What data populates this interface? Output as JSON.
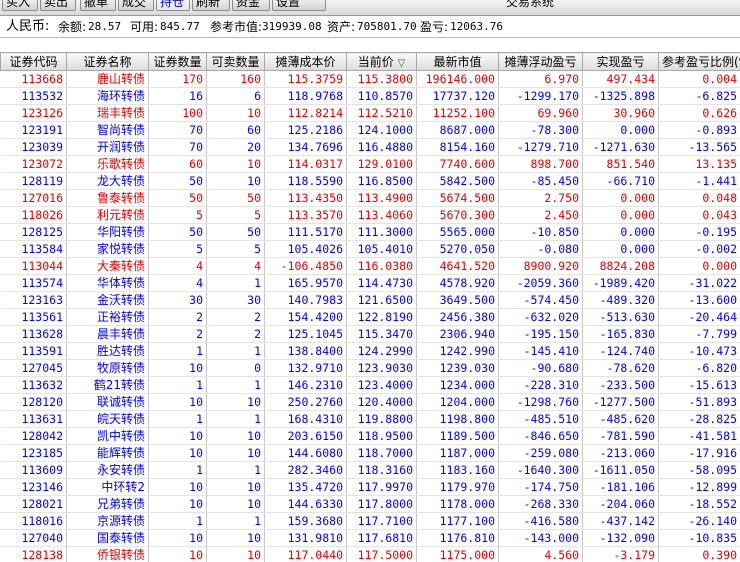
{
  "toolbar": {
    "buttons": [
      "买入",
      "卖出",
      "撤单",
      "成交",
      "持仓",
      "刷新",
      "资金",
      "设置"
    ],
    "title": "交易系统"
  },
  "summary": {
    "currency_label": "人民币:",
    "balance_label": "余额:",
    "balance": "28.57",
    "available_label": "可用:",
    "available": "845.77",
    "market_value_label": "参考市值:",
    "market_value": "319939.08",
    "assets_label": "资产:",
    "assets": "705801.70",
    "pnl_label": "盈亏:",
    "pnl": "12063.76"
  },
  "columns": [
    "证券代码",
    "证券名称",
    "证券数量",
    "可卖数量",
    "摊薄成本价",
    "当前价",
    "最新市值",
    "摊薄浮动盈亏",
    "实现盈亏",
    "参考盈亏比例(%)"
  ],
  "sort_indicator": "▽",
  "colors": {
    "up": "#e60000",
    "down": "#0000ff",
    "header_bg": "#e4e4e4"
  },
  "rows": [
    {
      "code": "113668",
      "name": "鹿山转债",
      "qty": "170",
      "sell": "160",
      "cost": "115.3759",
      "price": "115.3800",
      "mv": "196146.000",
      "float": "6.970",
      "real": "497.434",
      "ratio": "0.004",
      "dir": "up"
    },
    {
      "code": "113532",
      "name": "海环转债",
      "qty": "16",
      "sell": "6",
      "cost": "118.9768",
      "price": "110.8570",
      "mv": "17737.120",
      "float": "-1299.170",
      "real": "-1325.898",
      "ratio": "-6.825",
      "dir": "dn"
    },
    {
      "code": "123126",
      "name": "瑞丰转债",
      "qty": "100",
      "sell": "10",
      "cost": "112.8214",
      "price": "112.5210",
      "mv": "11252.100",
      "float": "69.960",
      "real": "30.960",
      "ratio": "0.626",
      "dir": "up"
    },
    {
      "code": "123191",
      "name": "智尚转债",
      "qty": "70",
      "sell": "60",
      "cost": "125.2186",
      "price": "124.1000",
      "mv": "8687.000",
      "float": "-78.300",
      "real": "0.000",
      "ratio": "-0.893",
      "dir": "dn"
    },
    {
      "code": "123039",
      "name": "开润转债",
      "qty": "70",
      "sell": "20",
      "cost": "134.7696",
      "price": "116.4880",
      "mv": "8154.160",
      "float": "-1279.710",
      "real": "-1271.630",
      "ratio": "-13.565",
      "dir": "dn"
    },
    {
      "code": "123072",
      "name": "乐歌转债",
      "qty": "60",
      "sell": "10",
      "cost": "114.0317",
      "price": "129.0100",
      "mv": "7740.600",
      "float": "898.700",
      "real": "851.540",
      "ratio": "13.135",
      "dir": "up"
    },
    {
      "code": "128119",
      "name": "龙大转债",
      "qty": "50",
      "sell": "10",
      "cost": "118.5590",
      "price": "116.8500",
      "mv": "5842.500",
      "float": "-85.450",
      "real": "-66.710",
      "ratio": "-1.441",
      "dir": "dn"
    },
    {
      "code": "127016",
      "name": "鲁泰转债",
      "qty": "50",
      "sell": "50",
      "cost": "113.4350",
      "price": "113.4900",
      "mv": "5674.500",
      "float": "2.750",
      "real": "0.000",
      "ratio": "0.048",
      "dir": "up"
    },
    {
      "code": "118026",
      "name": "利元转债",
      "qty": "5",
      "sell": "5",
      "cost": "113.3570",
      "price": "113.4060",
      "mv": "5670.300",
      "float": "2.450",
      "real": "0.000",
      "ratio": "0.043",
      "dir": "up"
    },
    {
      "code": "128125",
      "name": "华阳转债",
      "qty": "50",
      "sell": "50",
      "cost": "111.5170",
      "price": "111.3000",
      "mv": "5565.000",
      "float": "-10.850",
      "real": "0.000",
      "ratio": "-0.195",
      "dir": "dn"
    },
    {
      "code": "113584",
      "name": "家悦转债",
      "qty": "5",
      "sell": "5",
      "cost": "105.4026",
      "price": "105.4010",
      "mv": "5270.050",
      "float": "-0.080",
      "real": "0.000",
      "ratio": "-0.002",
      "dir": "dn"
    },
    {
      "code": "113044",
      "name": "大秦转债",
      "qty": "4",
      "sell": "4",
      "cost": "-106.4850",
      "price": "116.0380",
      "mv": "4641.520",
      "float": "8900.920",
      "real": "8824.208",
      "ratio": "0.000",
      "dir": "up"
    },
    {
      "code": "113574",
      "name": "华体转债",
      "qty": "4",
      "sell": "1",
      "cost": "165.9570",
      "price": "114.4730",
      "mv": "4578.920",
      "float": "-2059.360",
      "real": "-1989.420",
      "ratio": "-31.022",
      "dir": "dn"
    },
    {
      "code": "123163",
      "name": "金沃转债",
      "qty": "30",
      "sell": "30",
      "cost": "140.7983",
      "price": "121.6500",
      "mv": "3649.500",
      "float": "-574.450",
      "real": "-489.320",
      "ratio": "-13.600",
      "dir": "dn"
    },
    {
      "code": "113561",
      "name": "正裕转债",
      "qty": "2",
      "sell": "2",
      "cost": "154.4200",
      "price": "122.8190",
      "mv": "2456.380",
      "float": "-632.020",
      "real": "-513.630",
      "ratio": "-20.464",
      "dir": "dn"
    },
    {
      "code": "113628",
      "name": "晨丰转债",
      "qty": "2",
      "sell": "2",
      "cost": "125.1045",
      "price": "115.3470",
      "mv": "2306.940",
      "float": "-195.150",
      "real": "-165.830",
      "ratio": "-7.799",
      "dir": "dn"
    },
    {
      "code": "113591",
      "name": "胜达转债",
      "qty": "1",
      "sell": "1",
      "cost": "138.8400",
      "price": "124.2990",
      "mv": "1242.990",
      "float": "-145.410",
      "real": "-124.740",
      "ratio": "-10.473",
      "dir": "dn"
    },
    {
      "code": "127045",
      "name": "牧原转债",
      "qty": "10",
      "sell": "0",
      "cost": "132.9710",
      "price": "123.9030",
      "mv": "1239.030",
      "float": "-90.680",
      "real": "-78.620",
      "ratio": "-6.820",
      "dir": "dn"
    },
    {
      "code": "113632",
      "name": "鹤21转债",
      "qty": "1",
      "sell": "1",
      "cost": "146.2310",
      "price": "123.4000",
      "mv": "1234.000",
      "float": "-228.310",
      "real": "-233.500",
      "ratio": "-15.613",
      "dir": "dn"
    },
    {
      "code": "128120",
      "name": "联诚转债",
      "qty": "10",
      "sell": "10",
      "cost": "250.2760",
      "price": "120.4000",
      "mv": "1204.000",
      "float": "-1298.760",
      "real": "-1277.500",
      "ratio": "-51.893",
      "dir": "dn"
    },
    {
      "code": "113631",
      "name": "皖天转债",
      "qty": "1",
      "sell": "1",
      "cost": "168.4310",
      "price": "119.8800",
      "mv": "1198.800",
      "float": "-485.510",
      "real": "-485.620",
      "ratio": "-28.825",
      "dir": "dn"
    },
    {
      "code": "128042",
      "name": "凯中转债",
      "qty": "10",
      "sell": "10",
      "cost": "203.6150",
      "price": "118.9500",
      "mv": "1189.500",
      "float": "-846.650",
      "real": "-781.590",
      "ratio": "-41.581",
      "dir": "dn"
    },
    {
      "code": "123185",
      "name": "能辉转债",
      "qty": "10",
      "sell": "10",
      "cost": "144.6080",
      "price": "118.7000",
      "mv": "1187.000",
      "float": "-259.080",
      "real": "-213.060",
      "ratio": "-17.916",
      "dir": "dn"
    },
    {
      "code": "113609",
      "name": "永安转债",
      "qty": "1",
      "sell": "1",
      "cost": "282.3460",
      "price": "118.3160",
      "mv": "1183.160",
      "float": "-1640.300",
      "real": "-1611.050",
      "ratio": "-58.095",
      "dir": "dn"
    },
    {
      "code": "123146",
      "name": "中环转2",
      "qty": "10",
      "sell": "10",
      "cost": "135.4720",
      "price": "117.9970",
      "mv": "1179.970",
      "float": "-174.750",
      "real": "-181.106",
      "ratio": "-12.899",
      "dir": "dn"
    },
    {
      "code": "128021",
      "name": "兄弟转债",
      "qty": "10",
      "sell": "10",
      "cost": "144.6330",
      "price": "117.8000",
      "mv": "1178.000",
      "float": "-268.330",
      "real": "-204.060",
      "ratio": "-18.552",
      "dir": "dn"
    },
    {
      "code": "118016",
      "name": "京源转债",
      "qty": "1",
      "sell": "1",
      "cost": "159.3680",
      "price": "117.7100",
      "mv": "1177.100",
      "float": "-416.580",
      "real": "-437.142",
      "ratio": "-26.140",
      "dir": "dn"
    },
    {
      "code": "127040",
      "name": "国泰转债",
      "qty": "10",
      "sell": "10",
      "cost": "131.9810",
      "price": "117.6810",
      "mv": "1176.810",
      "float": "-143.000",
      "real": "-132.090",
      "ratio": "-10.835",
      "dir": "dn"
    },
    {
      "code": "128138",
      "name": "侨银转债",
      "qty": "10",
      "sell": "10",
      "cost": "117.0440",
      "price": "117.5000",
      "mv": "1175.000",
      "float": "4.560",
      "real": "-3.179",
      "ratio": "0.390",
      "dir": "up"
    }
  ]
}
